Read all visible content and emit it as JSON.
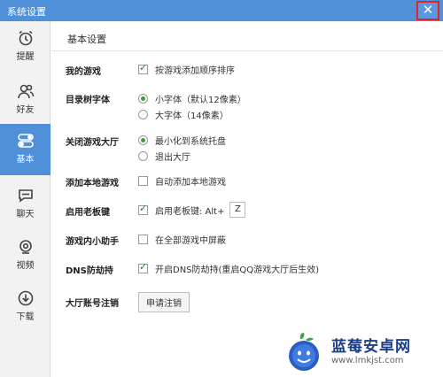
{
  "window": {
    "title": "系统设置",
    "close_glyph": "✕"
  },
  "sidebar": {
    "items": [
      {
        "label": "提醒",
        "icon": "alarm-clock-icon",
        "active": false
      },
      {
        "label": "好友",
        "icon": "friends-icon",
        "active": false
      },
      {
        "label": "基本",
        "icon": "toggle-icon",
        "active": true
      },
      {
        "label": "聊天",
        "icon": "chat-bubble-icon",
        "active": false
      },
      {
        "label": "视频",
        "icon": "webcam-icon",
        "active": false
      },
      {
        "label": "下载",
        "icon": "download-icon",
        "active": false
      }
    ]
  },
  "section": {
    "title": "基本设置"
  },
  "settings": {
    "my_games": {
      "label": "我的游戏",
      "option": "按游戏添加顺序排序",
      "checked": true
    },
    "tree_font": {
      "label": "目录树字体",
      "options": [
        "小字体（默认12像素）",
        "大字体（14像素）"
      ],
      "selected": 0
    },
    "close_hall": {
      "label": "关闭游戏大厅",
      "options": [
        "最小化到系统托盘",
        "退出大厅"
      ],
      "selected": 0
    },
    "add_local": {
      "label": "添加本地游戏",
      "option": "自动添加本地游戏",
      "checked": false
    },
    "boss_key": {
      "label": "启用老板键",
      "option": "启用老板键: Alt+",
      "key": "Z",
      "checked": true
    },
    "in_game_helper": {
      "label": "游戏内小助手",
      "option": "在全部游戏中屏蔽",
      "checked": false
    },
    "dns": {
      "label": "DNS防劫持",
      "option": "开启DNS防劫持(重启QQ游戏大厅后生效)",
      "checked": true
    },
    "logout": {
      "label": "大厅账号注销",
      "button": "申请注销"
    }
  },
  "watermark": {
    "text": "蓝莓安卓网",
    "url": "www.lmkjst.com"
  },
  "colors": {
    "accent": "#4f90d9",
    "close_border": "#e0242b",
    "check": "#2a7a2a",
    "brand": "#1a3f8a"
  }
}
